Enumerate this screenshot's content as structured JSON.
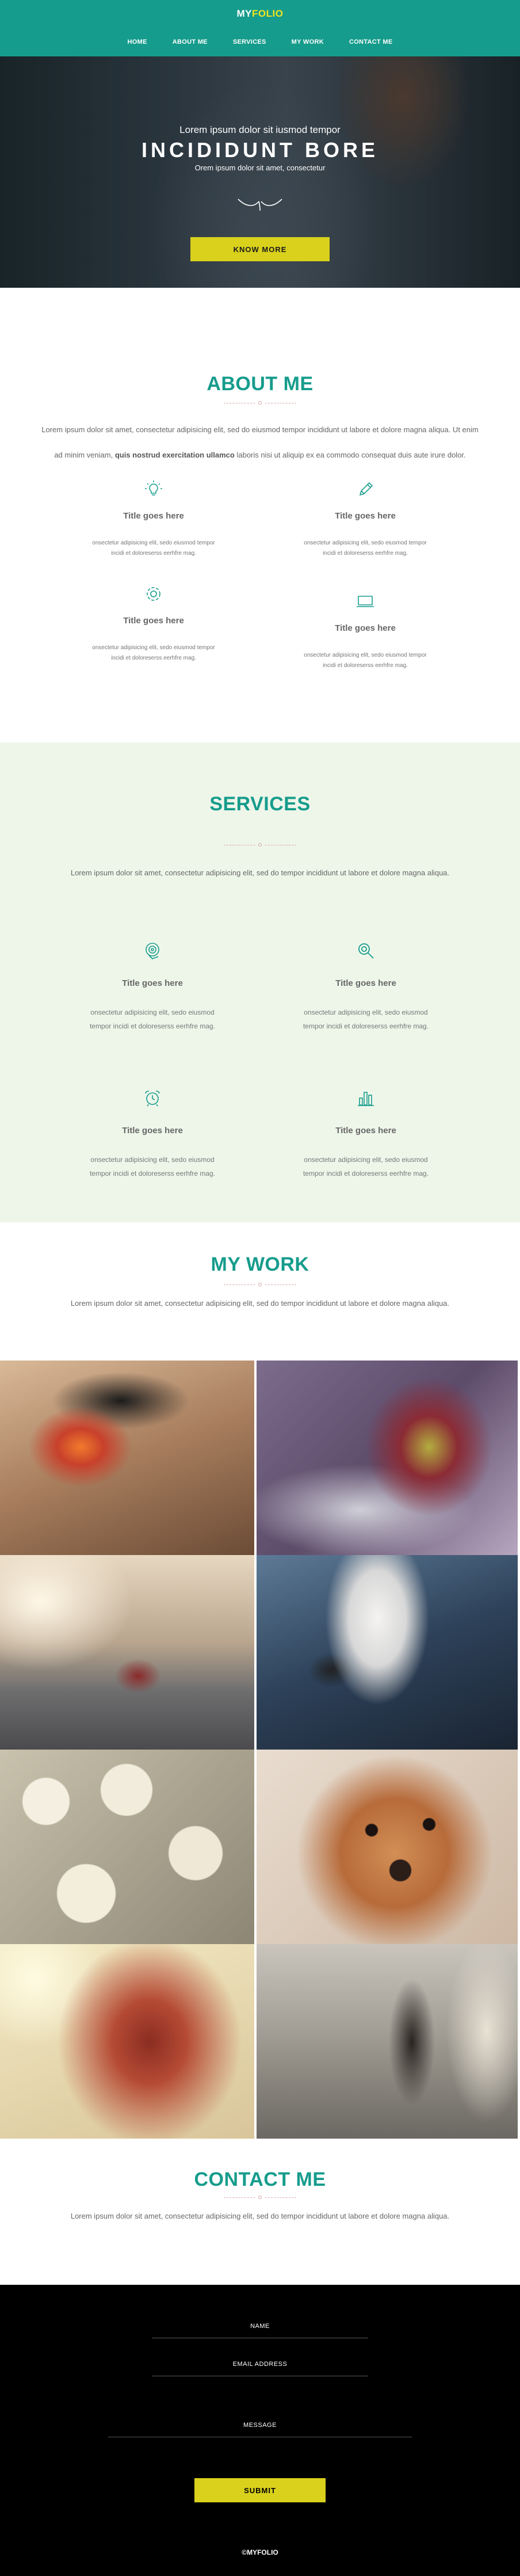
{
  "brand": {
    "part1": "MY",
    "part2": "FOLIO",
    "accent": "#169c8c",
    "highlight": "#d9d11c"
  },
  "nav": {
    "items": [
      "HOME",
      "ABOUT ME",
      "SERVICES",
      "MY WORK",
      "CONTACT ME"
    ]
  },
  "hero": {
    "subtitle": "Lorem ipsum dolor sit iusmod tempor",
    "title": "INCIDIDUNT BORE",
    "tagline": "Orem ipsum dolor sit amet, consectetur",
    "button": "KNOW MORE"
  },
  "about": {
    "title": "ABOUT ME",
    "intro_line1": "Lorem ipsum dolor sit amet, consectetur adipisicing elit, sed do eiusmod tempor incididunt ut labore et dolore magna aliqua. Ut enim",
    "intro_line2_pre": "ad minim veniam, ",
    "intro_line2_bold": "quis nostrud exercitation ullamco",
    "intro_line2_post": " laboris nisi ut aliquip ex ea commodo consequat duis aute irure dolor.",
    "cards": [
      {
        "icon": "lightbulb-icon",
        "title": "Title goes here",
        "text": "onsectetur adipisicing elit, sedo eiusmod tempor incidi et doloreserss eerhfre mag."
      },
      {
        "icon": "pencil-icon",
        "title": "Title goes here",
        "text": "onsectetur adipisicing elit, sedo eiusmod tempor incidi et doloreserss eerhfre mag."
      },
      {
        "icon": "gear-icon",
        "title": "Title goes here",
        "text": "onsectetur adipisicing elit, sedo eiusmod tempor incidi et doloreserss eerhfre mag."
      },
      {
        "icon": "monitor-icon",
        "title": "Title goes here",
        "text": "onsectetur adipisicing elit, sedo eiusmod tempor incidi et doloreserss eerhfre mag."
      }
    ]
  },
  "services": {
    "title": "SERVICES",
    "intro": "Lorem ipsum dolor sit amet, consectetur adipisicing elit, sed do tempor incididunt ut labore et dolore magna aliqua.",
    "items": [
      {
        "icon": "target-hand-icon",
        "title": "Title goes here",
        "text": "onsectetur adipisicing elit, sedo eiusmod tempor incidi et doloreserss eerhfre mag."
      },
      {
        "icon": "magnifier-icon",
        "title": "Title goes here",
        "text": "onsectetur adipisicing elit, sedo eiusmod tempor incidi et doloreserss eerhfre mag."
      },
      {
        "icon": "alarm-clock-icon",
        "title": "Title goes here",
        "text": "onsectetur adipisicing elit, sedo eiusmod tempor incidi et doloreserss eerhfre mag."
      },
      {
        "icon": "bar-chart-icon",
        "title": "Title goes here",
        "text": "onsectetur adipisicing elit, sedo eiusmod tempor incidi et doloreserss eerhfre mag."
      }
    ]
  },
  "work": {
    "title": "MY WORK",
    "intro": "Lorem ipsum dolor sit amet, consectetur adipisicing elit, sed do tempor incididunt ut labore et dolore magna aliqua.",
    "photos": [
      "sunglasses",
      "frosted leaf",
      "car on road",
      "swan",
      "banana slices",
      "small dog",
      "red hair",
      "woman walking on street"
    ]
  },
  "contact": {
    "title": "CONTACT ME",
    "intro": "Lorem ipsum dolor sit amet, consectetur adipisicing elit, sed do tempor incididunt ut labore et dolore magna aliqua.",
    "name_label": "NAME",
    "email_label": "EMAIL ADDRESS",
    "message_label": "MESSAGE",
    "submit": "SUBMIT"
  },
  "footer": {
    "logo": "©MYFOLIO"
  }
}
